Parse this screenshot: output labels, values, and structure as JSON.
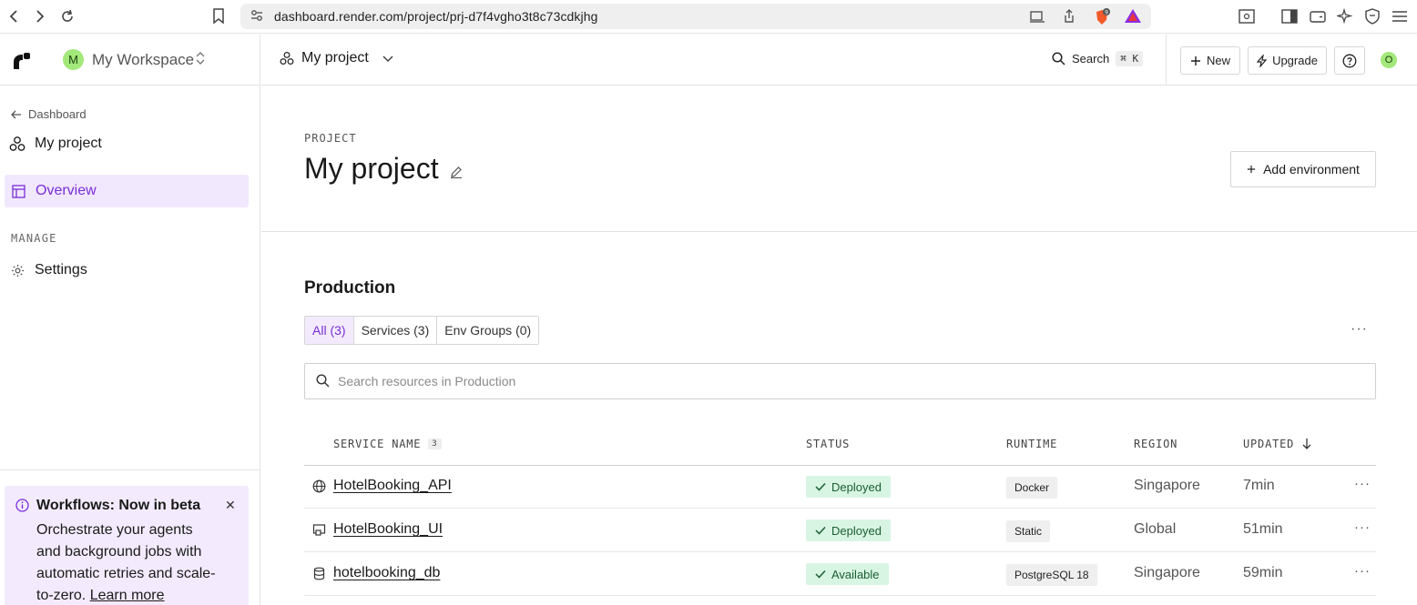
{
  "browser": {
    "url": "dashboard.render.com/project/prj-d7f4vgho3t8c73cdkjhg",
    "brave_badge": "9"
  },
  "sidebar": {
    "workspace_initial": "M",
    "workspace_name": "My Workspace",
    "back_label": "Dashboard",
    "project_name": "My project",
    "nav_overview": "Overview",
    "manage_label": "MANAGE",
    "nav_settings": "Settings",
    "beta": {
      "title": "Workflows: Now in beta",
      "body": "Orchestrate your agents and background jobs with automatic retries and scale-to-zero.",
      "link": "Learn more"
    }
  },
  "header": {
    "project_switch": "My project",
    "search_label": "Search",
    "search_kbd": "⌘ K",
    "new_label": "New",
    "upgrade_label": "Upgrade",
    "user_initial": "O"
  },
  "project": {
    "eyebrow": "PROJECT",
    "title": "My project",
    "add_env_label": "Add environment"
  },
  "production": {
    "title": "Production",
    "tabs": [
      {
        "label": "All (3)",
        "active": true
      },
      {
        "label": "Services (3)",
        "active": false
      },
      {
        "label": "Env Groups (0)",
        "active": false
      }
    ],
    "search_placeholder": "Search resources in Production",
    "columns": {
      "name": "SERVICE NAME",
      "name_count": "3",
      "status": "STATUS",
      "runtime": "RUNTIME",
      "region": "REGION",
      "updated": "UPDATED"
    },
    "rows": [
      {
        "icon": "globe-icon",
        "name": "HotelBooking_API",
        "status": "Deployed",
        "runtime": "Docker",
        "region": "Singapore",
        "updated": "7min"
      },
      {
        "icon": "static-site-icon",
        "name": "HotelBooking_UI",
        "status": "Deployed",
        "runtime": "Static",
        "region": "Global",
        "updated": "51min"
      },
      {
        "icon": "database-icon",
        "name": "hotelbooking_db",
        "status": "Available",
        "runtime": "PostgreSQL 18",
        "region": "Singapore",
        "updated": "59min"
      }
    ]
  },
  "colors": {
    "accent_purple": "#7a2ed6",
    "active_bg": "#f1e8fe",
    "status_bg": "#d8f5e3",
    "status_text": "#1a5e33",
    "avatar_green": "#a3e87a"
  }
}
